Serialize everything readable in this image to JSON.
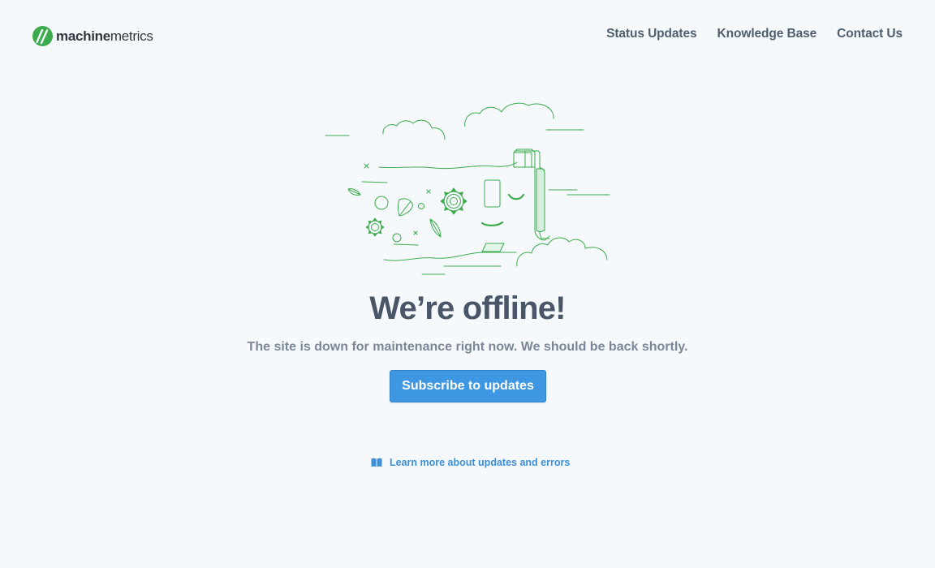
{
  "brand": {
    "name_bold": "machine",
    "name_light": "metrics",
    "logo_color": "#3bab4b"
  },
  "nav": {
    "items": [
      {
        "label": "Status Updates",
        "name": "nav-status-updates"
      },
      {
        "label": "Knowledge Base",
        "name": "nav-knowledge-base"
      },
      {
        "label": "Contact Us",
        "name": "nav-contact-us"
      }
    ]
  },
  "main": {
    "illustration_icon": "offline-machine-illustration",
    "headline": "We’re offline!",
    "subline": "The site is down for maintenance right now. We should be back shortly.",
    "subscribe_label": "Subscribe to updates",
    "learn_more": {
      "icon": "book-icon",
      "label": "Learn more about updates and errors"
    }
  },
  "colors": {
    "background": "#f5f9fc",
    "accent_green": "#3bab4b",
    "button_blue": "#3d97e2",
    "link_blue": "#3d8fd6",
    "headline": "#4a5567",
    "subtext": "#7b8797"
  }
}
